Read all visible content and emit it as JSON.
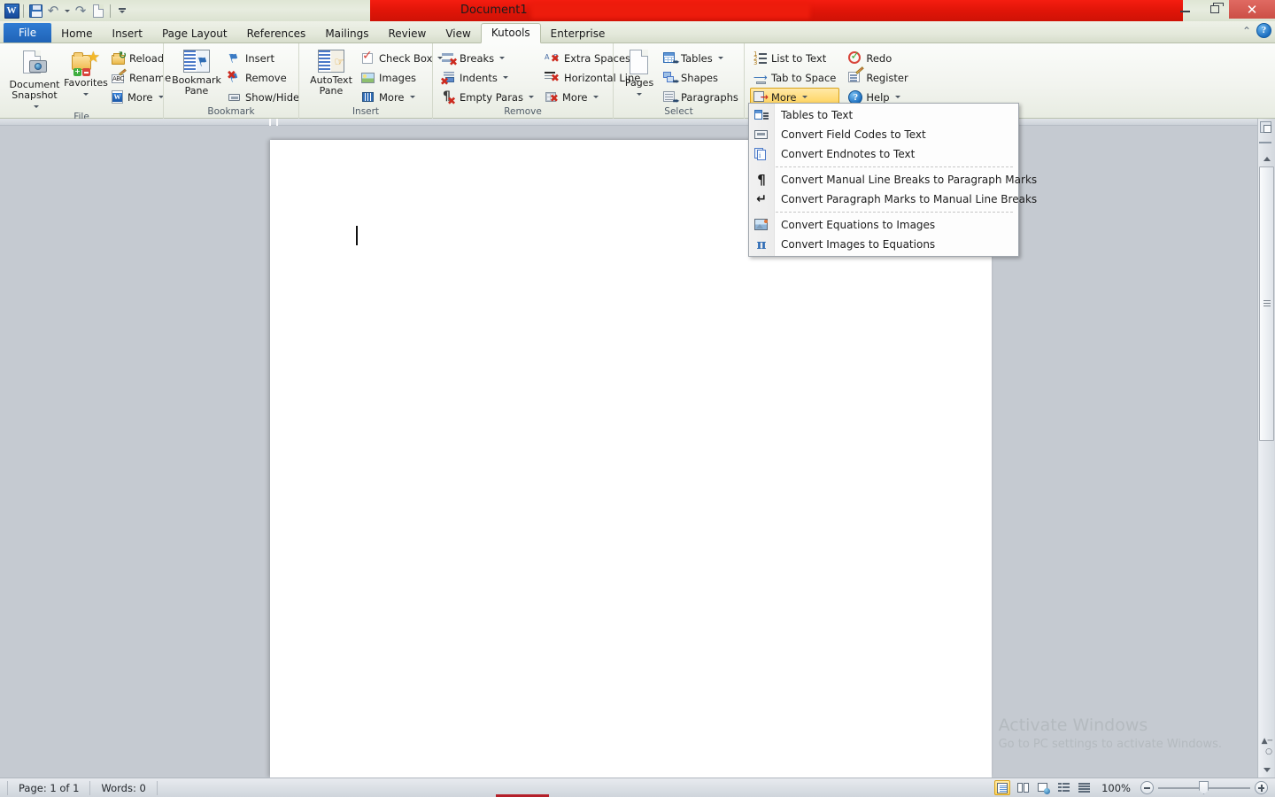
{
  "window": {
    "title": "Document1",
    "quick_access": [
      {
        "name": "word-logo",
        "label": "W"
      },
      {
        "name": "save-icon",
        "label": "Save"
      },
      {
        "name": "undo-icon",
        "label": "Undo"
      },
      {
        "name": "redo-icon",
        "label": "Redo"
      },
      {
        "name": "new-document-icon",
        "label": "New"
      },
      {
        "name": "customize-quick-access-icon",
        "label": "Customize Quick Access Toolbar"
      }
    ],
    "controls": {
      "minimize": "Minimize",
      "restore": "Restore Down",
      "close": "✕"
    }
  },
  "tabs": [
    {
      "id": "file",
      "label": "File",
      "active": false
    },
    {
      "id": "home",
      "label": "Home",
      "active": false
    },
    {
      "id": "insert",
      "label": "Insert",
      "active": false
    },
    {
      "id": "page-layout",
      "label": "Page Layout",
      "active": false
    },
    {
      "id": "references",
      "label": "References",
      "active": false
    },
    {
      "id": "mailings",
      "label": "Mailings",
      "active": false
    },
    {
      "id": "review",
      "label": "Review",
      "active": false
    },
    {
      "id": "view",
      "label": "View",
      "active": false
    },
    {
      "id": "kutools",
      "label": "Kutools",
      "active": true
    },
    {
      "id": "enterprise",
      "label": "Enterprise",
      "active": false
    }
  ],
  "ribbon_right": {
    "collapse_label": "⌃",
    "help_label": "?"
  },
  "ribbon": {
    "groups": [
      {
        "id": "file",
        "label": "File",
        "big_buttons": [
          {
            "name": "document-snapshot-button",
            "label": "Document\nSnapshot",
            "label_line1": "Document",
            "label_line2": "Snapshot",
            "has_dropdown": true,
            "icon": "document-snapshot-icon"
          },
          {
            "name": "favorites-button",
            "label": "Favorites",
            "label_line1": "Favorites",
            "label_line2": "",
            "has_dropdown": true,
            "icon": "favorites-folder-star-icon"
          }
        ],
        "small_buttons": [
          {
            "name": "reload-button",
            "label": "Reload",
            "has_dropdown": false,
            "icon": "reload-folder-icon"
          },
          {
            "name": "rename-button",
            "label": "Rename",
            "has_dropdown": false,
            "icon": "rename-abc-pencil-icon"
          },
          {
            "name": "file-more-button",
            "label": "More",
            "has_dropdown": true,
            "icon": "word-document-icon"
          }
        ]
      },
      {
        "id": "bookmark",
        "label": "Bookmark",
        "big_buttons": [
          {
            "name": "bookmark-pane-button",
            "label_line1": "Bookmark",
            "label_line2": "Pane",
            "has_dropdown": false,
            "icon": "bookmark-pane-icon"
          }
        ],
        "small_buttons": [
          {
            "name": "bookmark-insert-button",
            "label": "Insert",
            "has_dropdown": false,
            "icon": "bookmark-flag-icon"
          },
          {
            "name": "bookmark-remove-button",
            "label": "Remove",
            "has_dropdown": false,
            "icon": "bookmark-flag-delete-icon"
          },
          {
            "name": "bookmark-show-hide-button",
            "label": "Show/Hide",
            "has_dropdown": false,
            "icon": "show-hide-bookmark-icon"
          }
        ]
      },
      {
        "id": "insert",
        "label": "Insert",
        "big_buttons": [
          {
            "name": "autotext-pane-button",
            "label_line1": "AutoText",
            "label_line2": "Pane",
            "has_dropdown": false,
            "icon": "autotext-pane-icon"
          }
        ],
        "small_buttons": [
          {
            "name": "check-box-button",
            "label": "Check Box",
            "has_dropdown": true,
            "icon": "check-box-icon"
          },
          {
            "name": "images-button",
            "label": "Images",
            "has_dropdown": false,
            "icon": "images-icon"
          },
          {
            "name": "insert-more-button",
            "label": "More",
            "has_dropdown": true,
            "icon": "barcode-icon"
          }
        ]
      },
      {
        "id": "remove",
        "label": "Remove",
        "small_buttons_col1": [
          {
            "name": "remove-breaks-button",
            "label": "Breaks",
            "has_dropdown": true,
            "icon": "remove-breaks-icon"
          },
          {
            "name": "remove-indents-button",
            "label": "Indents",
            "has_dropdown": true,
            "icon": "remove-indents-icon"
          },
          {
            "name": "remove-empty-paras-button",
            "label": "Empty Paras",
            "has_dropdown": true,
            "icon": "remove-empty-paragraphs-icon"
          }
        ],
        "small_buttons_col2": [
          {
            "name": "remove-extra-spaces-button",
            "label": "Extra Spaces",
            "has_dropdown": false,
            "icon": "remove-extra-spaces-icon"
          },
          {
            "name": "remove-horizontal-line-button",
            "label": "Horizontal Line",
            "has_dropdown": false,
            "icon": "remove-horizontal-line-icon"
          },
          {
            "name": "remove-more-button",
            "label": "More",
            "has_dropdown": true,
            "icon": "remove-more-icon"
          }
        ]
      },
      {
        "id": "select",
        "label": "Select",
        "has_dialog_launcher": true,
        "big_buttons": [
          {
            "name": "select-pages-button",
            "label_line1": "Pages",
            "label_line2": "",
            "has_dropdown": true,
            "icon": "page-icon"
          }
        ],
        "small_buttons": [
          {
            "name": "select-tables-button",
            "label": "Tables",
            "has_dropdown": true,
            "icon": "select-tables-icon"
          },
          {
            "name": "select-shapes-button",
            "label": "Shapes",
            "has_dropdown": false,
            "icon": "select-shapes-icon"
          },
          {
            "name": "select-paragraphs-button",
            "label": "Paragraphs",
            "has_dropdown": true,
            "icon": "select-paragraphs-icon"
          }
        ]
      },
      {
        "id": "convert",
        "label": "",
        "small_buttons_col1": [
          {
            "name": "list-to-text-button",
            "label": "List to Text",
            "has_dropdown": false,
            "icon": "list-to-text-icon"
          },
          {
            "name": "tab-to-space-button",
            "label": "Tab to Space",
            "has_dropdown": false,
            "icon": "tab-to-space-icon"
          },
          {
            "name": "convert-more-button",
            "label": "More",
            "has_dropdown": true,
            "icon": "convert-more-icon",
            "highlighted": true
          }
        ],
        "small_buttons_col2": [
          {
            "name": "redo-button",
            "label": "Redo",
            "has_dropdown": false,
            "icon": "redo-check-icon"
          },
          {
            "name": "register-button",
            "label": "Register",
            "has_dropdown": false,
            "icon": "register-icon"
          },
          {
            "name": "help-button",
            "label": "Help",
            "has_dropdown": true,
            "icon": "help-circle-icon"
          }
        ]
      }
    ]
  },
  "dropdown_menu": {
    "name": "convert-more-menu",
    "items": [
      {
        "name": "menu-tables-to-text",
        "label": "Tables to Text",
        "icon": "tables-to-text-icon",
        "separator_after": false
      },
      {
        "name": "menu-convert-field-codes-to-text",
        "label": "Convert Field Codes to Text",
        "icon": "field-code-icon",
        "separator_after": false
      },
      {
        "name": "menu-convert-endnotes-to-text",
        "label": "Convert Endnotes to Text",
        "icon": "endnote-icon",
        "separator_after": true
      },
      {
        "name": "menu-convert-manual-line-breaks-to-paragraph-marks",
        "label": "Convert Manual Line Breaks to Paragraph Marks",
        "icon": "pilcrow-icon",
        "separator_after": false
      },
      {
        "name": "menu-convert-paragraph-marks-to-manual-line-breaks",
        "label": "Convert Paragraph Marks to Manual Line Breaks",
        "icon": "enter-arrow-icon",
        "separator_after": true
      },
      {
        "name": "menu-convert-equations-to-images",
        "label": "Convert Equations to Images",
        "icon": "equation-to-image-icon",
        "separator_after": false
      },
      {
        "name": "menu-convert-images-to-equations",
        "label": "Convert Images to Equations",
        "icon": "pi-icon",
        "separator_after": false
      }
    ]
  },
  "document": {
    "caret_visible": true
  },
  "watermark": {
    "line1": "Activate Windows",
    "line2": "Go to PC settings to activate Windows."
  },
  "statusbar": {
    "page_label": "Page: 1 of 1",
    "words_label": "Words: 0",
    "zoom_label": "100%",
    "view_buttons": [
      {
        "name": "view-print-layout-button",
        "label": "Print Layout",
        "selected": true
      },
      {
        "name": "view-full-screen-reading-button",
        "label": "Full Screen Reading",
        "selected": false
      },
      {
        "name": "view-web-layout-button",
        "label": "Web Layout",
        "selected": false
      },
      {
        "name": "view-outline-button",
        "label": "Outline",
        "selected": false
      },
      {
        "name": "view-draft-button",
        "label": "Draft",
        "selected": false
      }
    ],
    "zoom_out_label": "Zoom Out",
    "zoom_in_label": "Zoom In"
  },
  "colors": {
    "title_red": "#e01508",
    "accent_blue": "#2f7cd4",
    "highlight_yellow": "#ffd257",
    "workspace_gray": "#c5cad1"
  }
}
